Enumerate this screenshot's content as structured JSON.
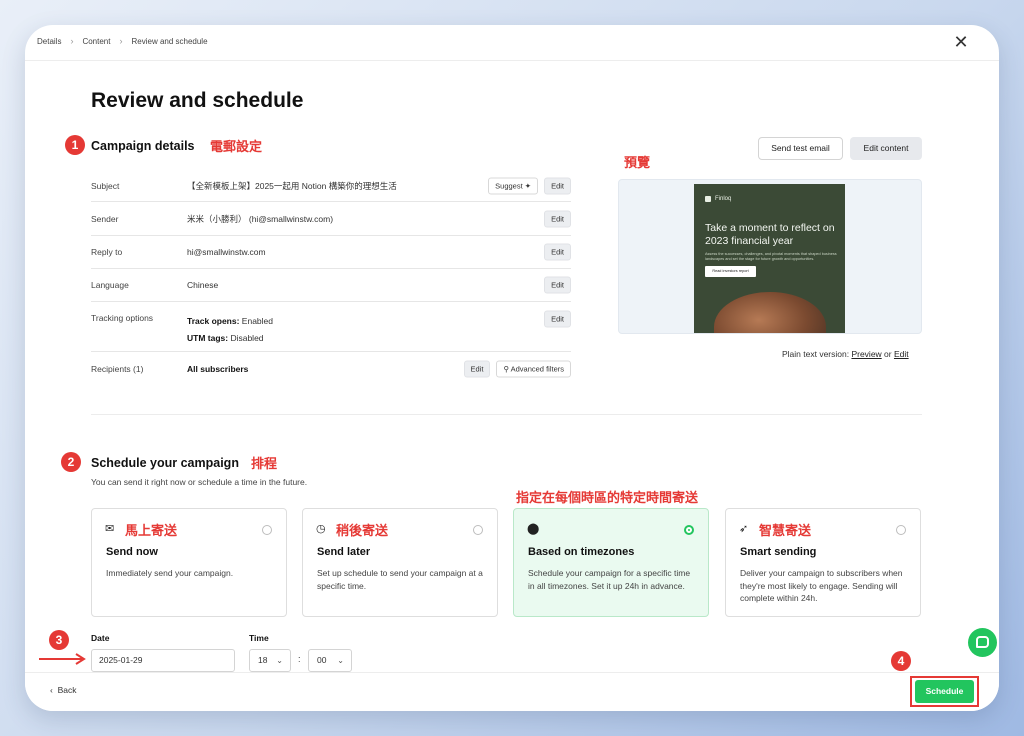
{
  "breadcrumb": {
    "items": [
      "Details",
      "Content",
      "Review and schedule"
    ]
  },
  "page_title": "Review and schedule",
  "icons": {
    "close": "close-icon",
    "suggest": "sparkle-icon",
    "filters": "filter-icon",
    "send_now": "envelope-open-icon",
    "send_later": "clock-icon",
    "timezone": "pin-icon",
    "smart": "cursor-click-icon",
    "chat": "chat-bubble-icon"
  },
  "annotations": {
    "step1": "1",
    "step2": "2",
    "step3": "3",
    "step4": "4",
    "campaign_settings": "電郵設定",
    "preview": "預覽",
    "schedule": "排程",
    "timezone_note": "指定在每個時區的特定時間寄送"
  },
  "campaign": {
    "title": "Campaign details",
    "rows": [
      {
        "label": "Subject",
        "value": "【全新模板上架】2025一起用 Notion 構築你的理想生活"
      },
      {
        "label": "Sender",
        "value": "米米（小勝利） (hi@smallwinstw.com)"
      },
      {
        "label": "Reply to",
        "value": "hi@smallwinstw.com"
      },
      {
        "label": "Language",
        "value": "Chinese"
      },
      {
        "label": "Tracking options",
        "track_opens_label": "Track opens:",
        "track_opens_value": " Enabled",
        "utm_label": "UTM tags:",
        "utm_value": " Disabled"
      },
      {
        "label": "Recipients (1)",
        "value": "All subscribers"
      }
    ],
    "edit_label": "Edit",
    "suggest_label": "Suggest",
    "advanced_filters_label": "Advanced filters"
  },
  "preview": {
    "send_test_label": "Send test email",
    "edit_content_label": "Edit content",
    "email": {
      "brand": "Finloq",
      "headline": "Take a moment to reflect on 2023 financial year",
      "body": "Assess the successes, challenges, and pivotal moments that shaped business landscapes and set the stage for future growth and opportunities.",
      "cta": "Read investors report"
    },
    "plain_text_prefix": "Plain text version: ",
    "plain_preview_link": "Preview",
    "plain_or": " or ",
    "plain_edit_link": "Edit"
  },
  "schedule": {
    "title": "Schedule your campaign",
    "subtitle": "You can send it right now or schedule a time in the future.",
    "options": [
      {
        "anno": "馬上寄送",
        "title": "Send now",
        "desc": "Immediately send your campaign."
      },
      {
        "anno": "稍後寄送",
        "title": "Send later",
        "desc": "Set up schedule to send your campaign at a specific time."
      },
      {
        "anno": "",
        "title": "Based on timezones",
        "desc": "Schedule your campaign for a specific time in all timezones. Set it up 24h in advance."
      },
      {
        "anno": "智慧寄送",
        "title": "Smart sending",
        "desc": "Deliver your campaign to subscribers when they're most likely to engage. Sending will complete within 24h."
      }
    ],
    "date_label": "Date",
    "date_value": "2025-01-29",
    "time_label": "Time",
    "hour": "18",
    "minute": "00",
    "time_sep": ":"
  },
  "footer": {
    "back_label": "Back",
    "schedule_label": "Schedule"
  }
}
